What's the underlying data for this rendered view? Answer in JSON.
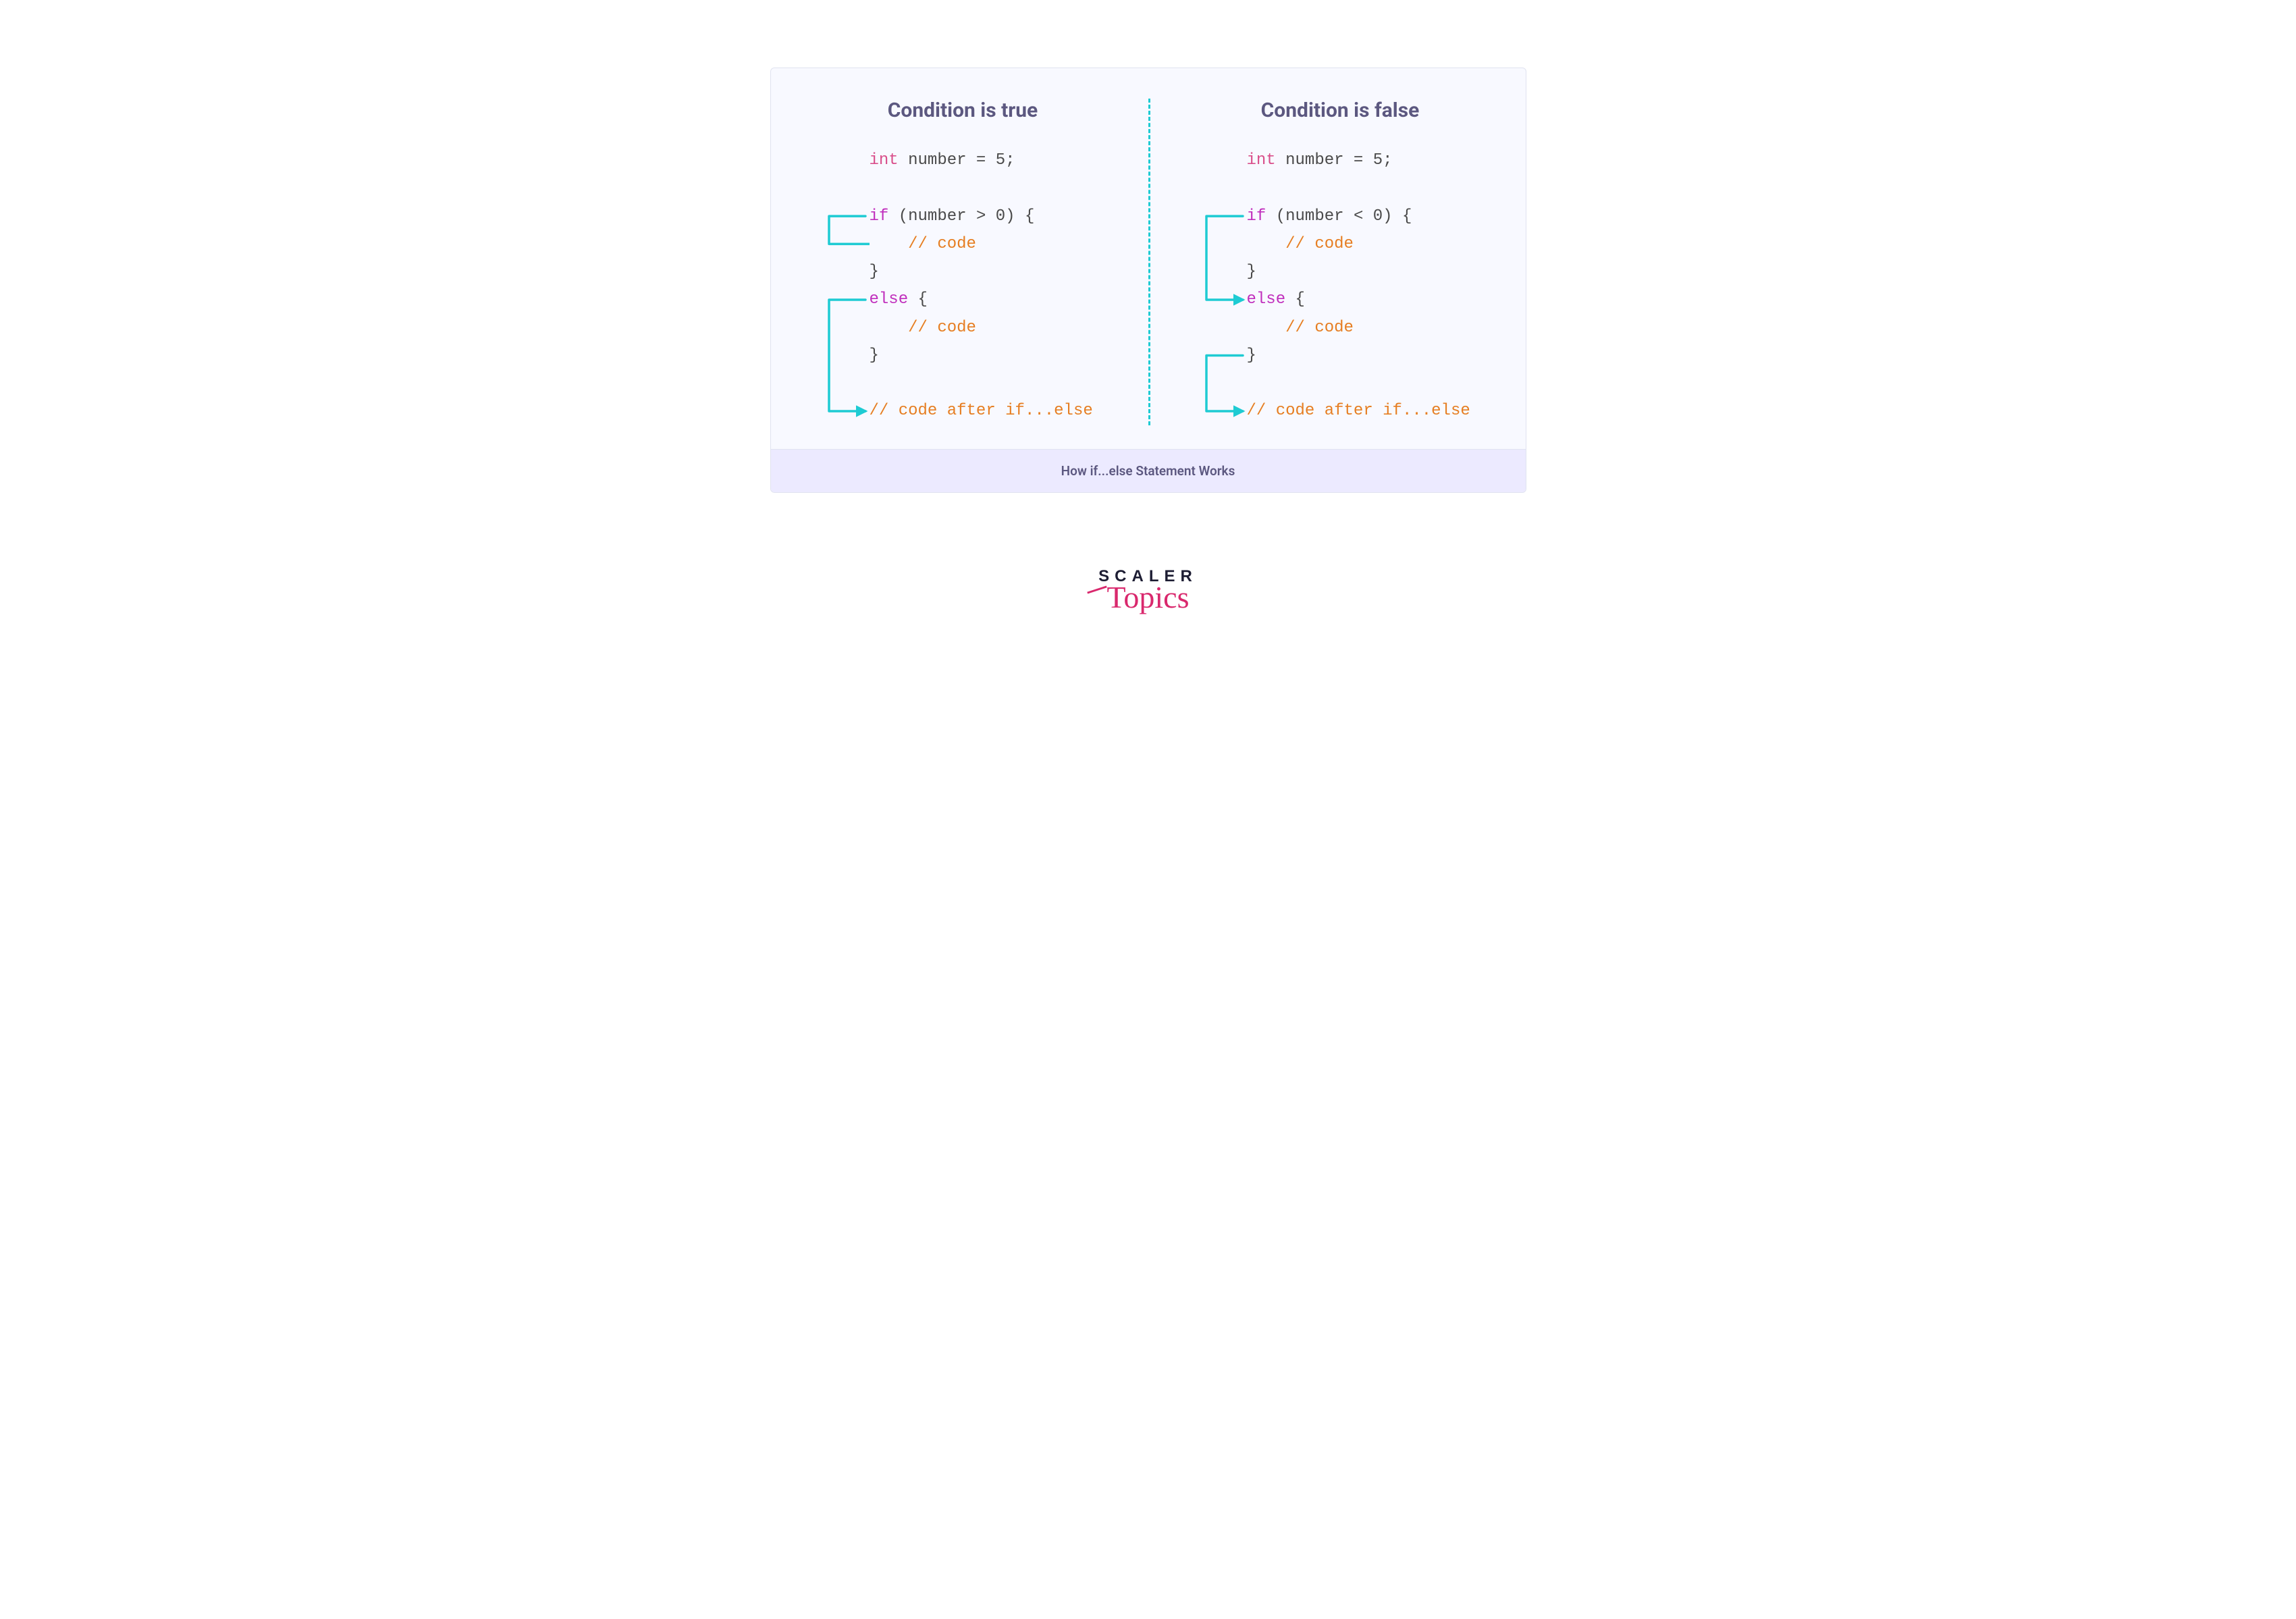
{
  "caption": "How if...else Statement Works",
  "brand": {
    "top": "SCALER",
    "bottom": "Topics"
  },
  "colors": {
    "panel_bg": "#f8f9ff",
    "title": "#5c5880",
    "arrow": "#1ecbd3",
    "type_kw": "#d94f8b",
    "keyword": "#c02fbd",
    "comment": "#e67e22"
  },
  "leftPanel": {
    "title": "Condition is true",
    "lines": [
      {
        "segments": [
          {
            "t": "int ",
            "c": "kw-type"
          },
          {
            "t": "number = 5;",
            "c": ""
          }
        ]
      },
      {
        "segments": [
          {
            "t": "",
            "c": ""
          }
        ]
      },
      {
        "segments": [
          {
            "t": "if ",
            "c": "kw"
          },
          {
            "t": "(number > 0) {",
            "c": ""
          }
        ]
      },
      {
        "segments": [
          {
            "t": "    // code",
            "c": "comment"
          }
        ]
      },
      {
        "segments": [
          {
            "t": "}",
            "c": ""
          }
        ]
      },
      {
        "segments": [
          {
            "t": "else ",
            "c": "kw"
          },
          {
            "t": "{",
            "c": ""
          }
        ]
      },
      {
        "segments": [
          {
            "t": "    // code",
            "c": "comment"
          }
        ]
      },
      {
        "segments": [
          {
            "t": "}",
            "c": ""
          }
        ]
      },
      {
        "segments": [
          {
            "t": "",
            "c": ""
          }
        ]
      },
      {
        "segments": [
          {
            "t": "// code after if...else",
            "c": "comment"
          }
        ]
      }
    ],
    "arrows": [
      {
        "fromLine": 2,
        "toLine": 3,
        "fromOffset": 28,
        "indentTo": true
      },
      {
        "fromLine": 5,
        "toLine": 9,
        "fromOffset": 28,
        "indentTo": false
      }
    ]
  },
  "rightPanel": {
    "title": "Condition is false",
    "lines": [
      {
        "segments": [
          {
            "t": "int ",
            "c": "kw-type"
          },
          {
            "t": "number = 5;",
            "c": ""
          }
        ]
      },
      {
        "segments": [
          {
            "t": "",
            "c": ""
          }
        ]
      },
      {
        "segments": [
          {
            "t": "if ",
            "c": "kw"
          },
          {
            "t": "(number < 0) {",
            "c": ""
          }
        ]
      },
      {
        "segments": [
          {
            "t": "    // code",
            "c": "comment"
          }
        ]
      },
      {
        "segments": [
          {
            "t": "}",
            "c": ""
          }
        ]
      },
      {
        "segments": [
          {
            "t": "else ",
            "c": "kw"
          },
          {
            "t": "{",
            "c": ""
          }
        ]
      },
      {
        "segments": [
          {
            "t": "    // code",
            "c": "comment"
          }
        ]
      },
      {
        "segments": [
          {
            "t": "}",
            "c": ""
          }
        ]
      },
      {
        "segments": [
          {
            "t": "",
            "c": ""
          }
        ]
      },
      {
        "segments": [
          {
            "t": "// code after if...else",
            "c": "comment"
          }
        ]
      }
    ],
    "arrows": [
      {
        "fromLine": 2,
        "toLine": 5,
        "fromOffset": 28,
        "indentTo": false
      },
      {
        "fromLine": 7,
        "toLine": 9,
        "fromOffset": 28,
        "indentTo": false
      }
    ]
  }
}
